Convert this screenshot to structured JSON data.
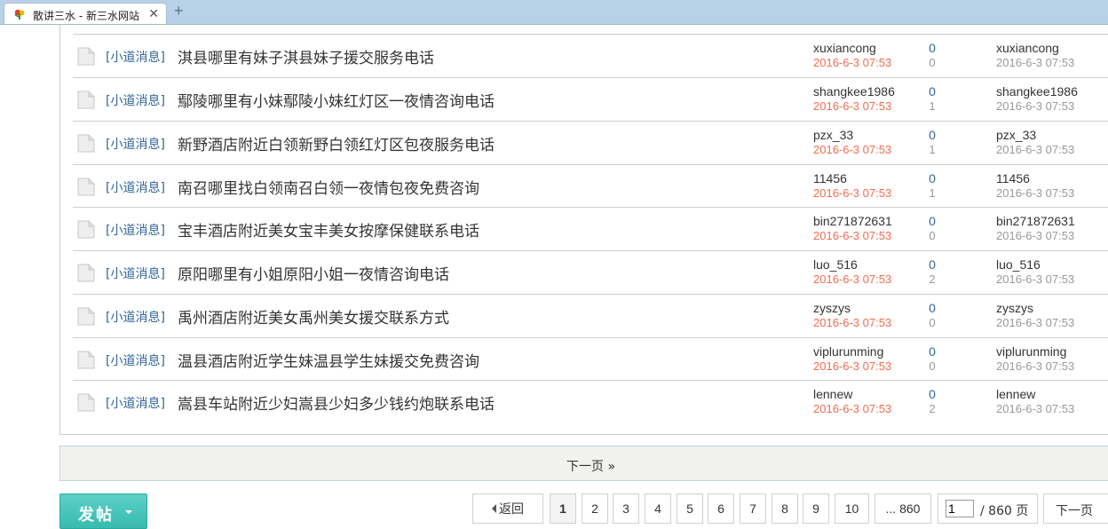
{
  "browser": {
    "tab_title": "散讲三水 - 新三水网站",
    "close_glyph": "✕",
    "new_tab_glyph": "+"
  },
  "threads": [
    {
      "category": "[小道消息]",
      "title": "淇县哪里有妹子淇县妹子援交服务电话",
      "author": "xuxiancong",
      "date": "2016-6-3 07:53",
      "replies": "0",
      "views": "0",
      "last_user": "xuxiancong",
      "last_date": "2016-6-3 07:53"
    },
    {
      "category": "[小道消息]",
      "title": "鄢陵哪里有小妹鄢陵小妹红灯区一夜情咨询电话",
      "author": "shangkee1986",
      "date": "2016-6-3 07:53",
      "replies": "0",
      "views": "1",
      "last_user": "shangkee1986",
      "last_date": "2016-6-3 07:53"
    },
    {
      "category": "[小道消息]",
      "title": "新野酒店附近白领新野白领红灯区包夜服务电话",
      "author": "pzx_33",
      "date": "2016-6-3 07:53",
      "replies": "0",
      "views": "1",
      "last_user": "pzx_33",
      "last_date": "2016-6-3 07:53"
    },
    {
      "category": "[小道消息]",
      "title": "南召哪里找白领南召白领一夜情包夜免费咨询",
      "author": "11456",
      "date": "2016-6-3 07:53",
      "replies": "0",
      "views": "1",
      "last_user": "11456",
      "last_date": "2016-6-3 07:53"
    },
    {
      "category": "[小道消息]",
      "title": "宝丰酒店附近美女宝丰美女按摩保健联系电话",
      "author": "bin271872631",
      "date": "2016-6-3 07:53",
      "replies": "0",
      "views": "0",
      "last_user": "bin271872631",
      "last_date": "2016-6-3 07:53"
    },
    {
      "category": "[小道消息]",
      "title": "原阳哪里有小姐原阳小姐一夜情咨询电话",
      "author": "luo_516",
      "date": "2016-6-3 07:53",
      "replies": "0",
      "views": "2",
      "last_user": "luo_516",
      "last_date": "2016-6-3 07:53"
    },
    {
      "category": "[小道消息]",
      "title": "禹州酒店附近美女禹州美女援交联系方式",
      "author": "zyszys",
      "date": "2016-6-3 07:53",
      "replies": "0",
      "views": "0",
      "last_user": "zyszys",
      "last_date": "2016-6-3 07:53"
    },
    {
      "category": "[小道消息]",
      "title": "温县酒店附近学生妹温县学生妹援交免费咨询",
      "author": "viplurunming",
      "date": "2016-6-3 07:53",
      "replies": "0",
      "views": "0",
      "last_user": "viplurunming",
      "last_date": "2016-6-3 07:53"
    },
    {
      "category": "[小道消息]",
      "title": "嵩县车站附近少妇嵩县少妇多少钱约炮联系电话",
      "author": "lennew",
      "date": "2016-6-3 07:53",
      "replies": "0",
      "views": "2",
      "last_user": "lennew",
      "last_date": "2016-6-3 07:53"
    }
  ],
  "next_page_bar": {
    "label": "下一页 »"
  },
  "post_button": {
    "label": "发帖"
  },
  "pagination": {
    "back_label": "返回",
    "pages": [
      "1",
      "2",
      "3",
      "4",
      "5",
      "6",
      "7",
      "8",
      "9",
      "10",
      "... 860"
    ],
    "current": "1",
    "jump_value": "1",
    "total_label": "/ 860 页",
    "next_label": "下一页"
  },
  "colors": {
    "category": "#336699",
    "date": "#f26c4f",
    "post_button": "#45c4ba",
    "tab_strip": "#b9d1e6"
  }
}
